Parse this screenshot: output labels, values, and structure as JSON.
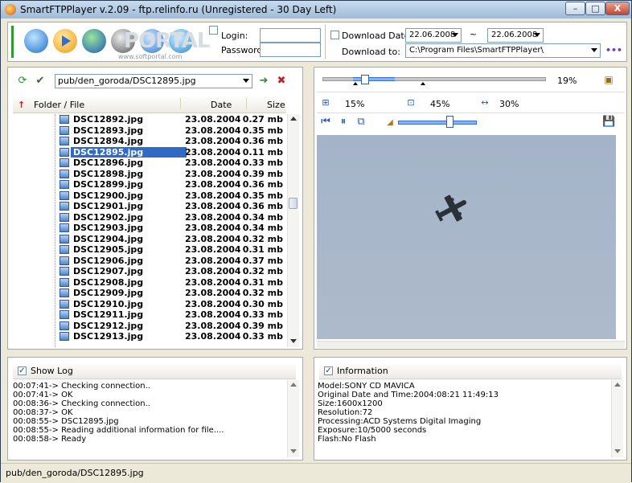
{
  "window": {
    "title": "SmartFTPPlayer v.2.09 - ftp.relinfo.ru (Unregistered - 30 Day Left)",
    "min_label": "–",
    "max_label": "□",
    "close_label": "X"
  },
  "connect": {
    "login_label": "Login:",
    "password_label": "Password:",
    "login_value": "",
    "password_value": ""
  },
  "download": {
    "date_label": "Download Date:",
    "date_from": "22.06.2008",
    "range_sep": "~",
    "date_to": "22.06.2008",
    "to_label": "Download to:",
    "to_path": "C:\\Program Files\\SmartFTPPlayer\\",
    "more_label": "•••"
  },
  "logo": {
    "text": "PORTAL",
    "sub": "www.softportal.com"
  },
  "browser": {
    "path": "pub/den_goroda/DSC12895.jpg",
    "columns": {
      "name": "Folder / File",
      "date": "Date",
      "size": "Size"
    },
    "files": [
      {
        "name": "DSC12892.jpg",
        "date": "23.08.2004",
        "size": "0.27 mb"
      },
      {
        "name": "DSC12893.jpg",
        "date": "23.08.2004",
        "size": "0.35 mb"
      },
      {
        "name": "DSC12894.jpg",
        "date": "23.08.2004",
        "size": "0.36 mb"
      },
      {
        "name": "DSC12895.jpg",
        "date": "23.08.2004",
        "size": "0.11 mb"
      },
      {
        "name": "DSC12896.jpg",
        "date": "23.08.2004",
        "size": "0.33 mb"
      },
      {
        "name": "DSC12898.jpg",
        "date": "23.08.2004",
        "size": "0.39 mb"
      },
      {
        "name": "DSC12899.jpg",
        "date": "23.08.2004",
        "size": "0.36 mb"
      },
      {
        "name": "DSC12900.jpg",
        "date": "23.08.2004",
        "size": "0.35 mb"
      },
      {
        "name": "DSC12901.jpg",
        "date": "23.08.2004",
        "size": "0.36 mb"
      },
      {
        "name": "DSC12902.jpg",
        "date": "23.08.2004",
        "size": "0.34 mb"
      },
      {
        "name": "DSC12903.jpg",
        "date": "23.08.2004",
        "size": "0.34 mb"
      },
      {
        "name": "DSC12904.jpg",
        "date": "23.08.2004",
        "size": "0.32 mb"
      },
      {
        "name": "DSC12905.jpg",
        "date": "23.08.2004",
        "size": "0.31 mb"
      },
      {
        "name": "DSC12906.jpg",
        "date": "23.08.2004",
        "size": "0.37 mb"
      },
      {
        "name": "DSC12907.jpg",
        "date": "23.08.2004",
        "size": "0.32 mb"
      },
      {
        "name": "DSC12908.jpg",
        "date": "23.08.2004",
        "size": "0.31 mb"
      },
      {
        "name": "DSC12909.jpg",
        "date": "23.08.2004",
        "size": "0.32 mb"
      },
      {
        "name": "DSC12910.jpg",
        "date": "23.08.2004",
        "size": "0.30 mb"
      },
      {
        "name": "DSC12911.jpg",
        "date": "23.08.2004",
        "size": "0.33 mb"
      },
      {
        "name": "DSC12912.jpg",
        "date": "23.08.2004",
        "size": "0.39 mb"
      },
      {
        "name": "DSC12913.jpg",
        "date": "23.08.2004",
        "size": "0.33 mb"
      }
    ],
    "selected_index": 3
  },
  "viewer": {
    "progress_pct": "19%",
    "zoom1": "15%",
    "zoom2": "45%",
    "zoom3": "30%",
    "progress_fraction": 0.19,
    "volume_fraction": 0.67
  },
  "log": {
    "caption": "Show Log",
    "lines": [
      "00:07:41-> Checking connection..",
      "00:07:41-> OK",
      "00:08:36-> Checking connection..",
      "00:08:37-> OK",
      "00:08:55-> DSC12895.jpg",
      "00:08:55-> Reading additional information for file....",
      "00:08:58-> Ready"
    ]
  },
  "info": {
    "caption": "Information",
    "lines": [
      "Model:SONY  CD MAVICA",
      "Original Date and Time:2004:08:21 11:49:13",
      "Size:1600x1200",
      "Resolution:72",
      "Processing:ACD Systems Digital Imaging",
      "Exposure:10/5000 seconds",
      "Flash:No Flash"
    ]
  },
  "status": {
    "text": "pub/den_goroda/DSC12895.jpg"
  },
  "colors": {
    "selection": "#316ac5",
    "accent_green": "#2f9b2f",
    "image_sky": "#a9b7c8"
  }
}
